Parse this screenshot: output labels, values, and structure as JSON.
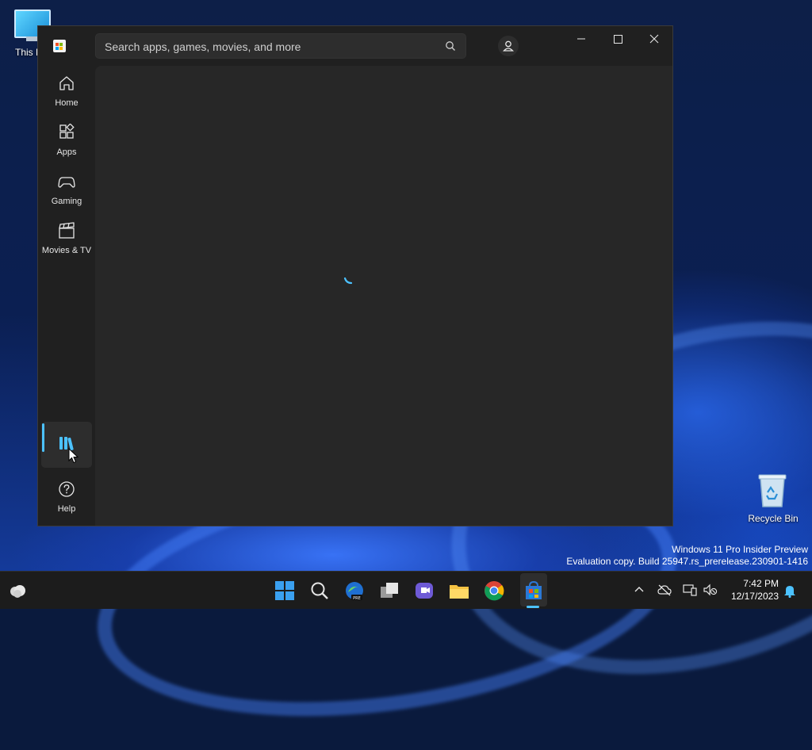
{
  "desktop": {
    "this_pc_label": "This P",
    "recycle_bin_label": "Recycle Bin",
    "watermark_line1": "Windows 11 Pro Insider Preview",
    "watermark_line2": "Evaluation copy. Build 25947.rs_prerelease.230901-1416"
  },
  "window": {
    "app_icon": "microsoft-store-icon",
    "search": {
      "placeholder": "Search apps, games, movies, and more",
      "icon": "search-icon"
    },
    "account_icon": "account-icon",
    "controls": {
      "minimize": "minimize-icon",
      "maximize": "maximize-icon",
      "close": "close-icon"
    },
    "accent": "#4cc2ff"
  },
  "sidebar": {
    "items": [
      {
        "label": "Home",
        "icon": "home-icon"
      },
      {
        "label": "Apps",
        "icon": "apps-icon"
      },
      {
        "label": "Gaming",
        "icon": "gaming-icon"
      },
      {
        "label": "Movies & TV",
        "icon": "movies-icon"
      }
    ],
    "library": {
      "label": "",
      "icon": "library-icon",
      "selected": true
    },
    "help": {
      "label": "Help",
      "icon": "help-icon"
    }
  },
  "content": {
    "state": "loading",
    "spinner_icon": "loading-spinner-icon"
  },
  "taskbar": {
    "apps": [
      "start-icon",
      "search-icon",
      "edge-dev-icon",
      "task-view-icon",
      "teams-icon",
      "file-explorer-icon",
      "chrome-icon",
      "microsoft-store-icon"
    ],
    "active_app": "microsoft-store-icon",
    "time": "7:42 PM",
    "date": "12/17/2023"
  }
}
